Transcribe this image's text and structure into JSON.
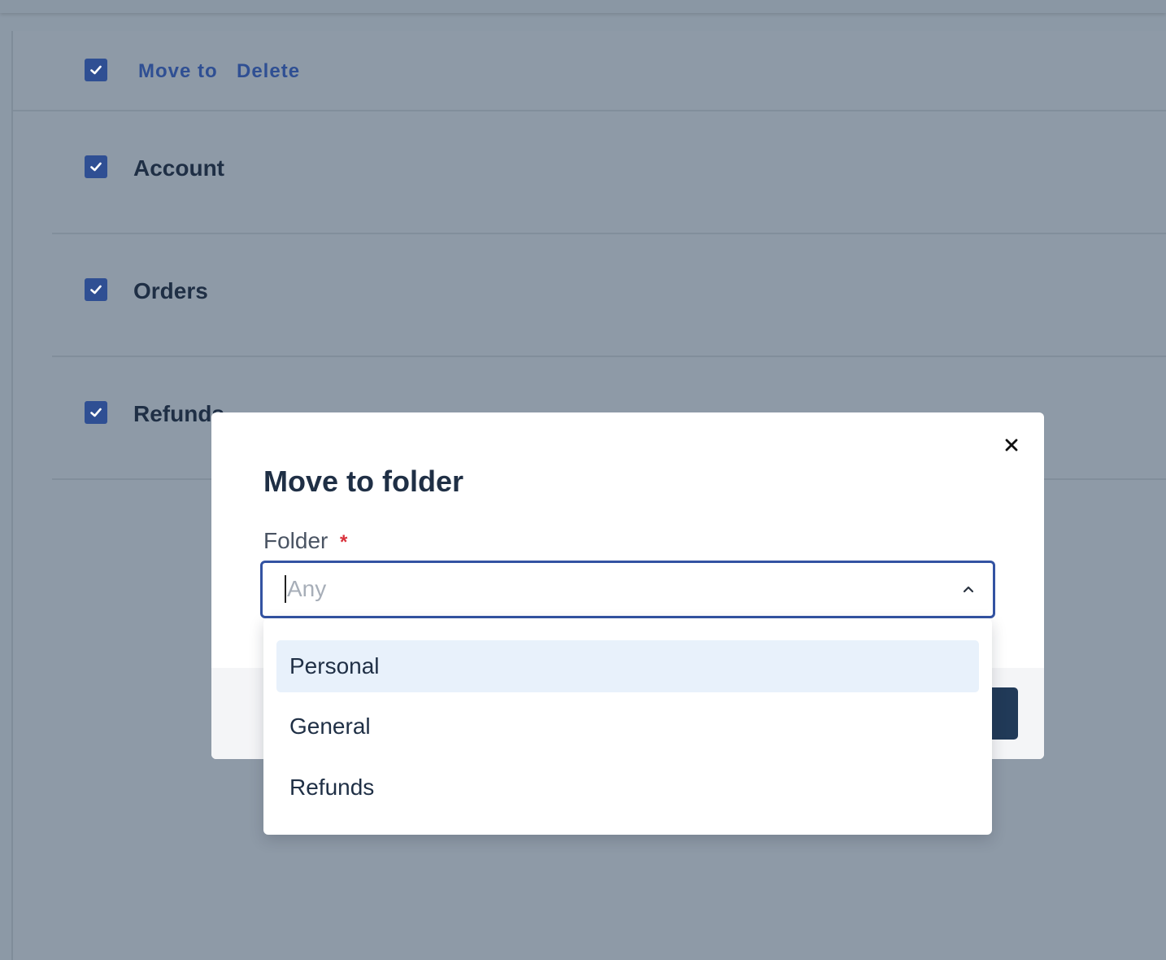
{
  "bulk_bar": {
    "move_to_label": "Move to",
    "delete_label": "Delete",
    "select_all_checked": true
  },
  "folders": [
    {
      "name": "Account",
      "checked": true
    },
    {
      "name": "Orders",
      "checked": true
    },
    {
      "name": "Refunds",
      "checked": true
    }
  ],
  "modal": {
    "title": "Move to folder",
    "field_label": "Folder",
    "required_mark": "*",
    "select_placeholder": "Any",
    "options": [
      "Personal",
      "General",
      "Refunds"
    ],
    "highlighted_option": "Personal"
  },
  "icons": {
    "checkbox": "check-icon",
    "close": "close-icon",
    "chevron": "chevron-up-icon"
  },
  "colors": {
    "accent": "#2f4f93",
    "focus_border": "#3353a2",
    "required": "#d9303a",
    "primary_button": "#213a58",
    "option_highlight": "#e8f1fb"
  }
}
